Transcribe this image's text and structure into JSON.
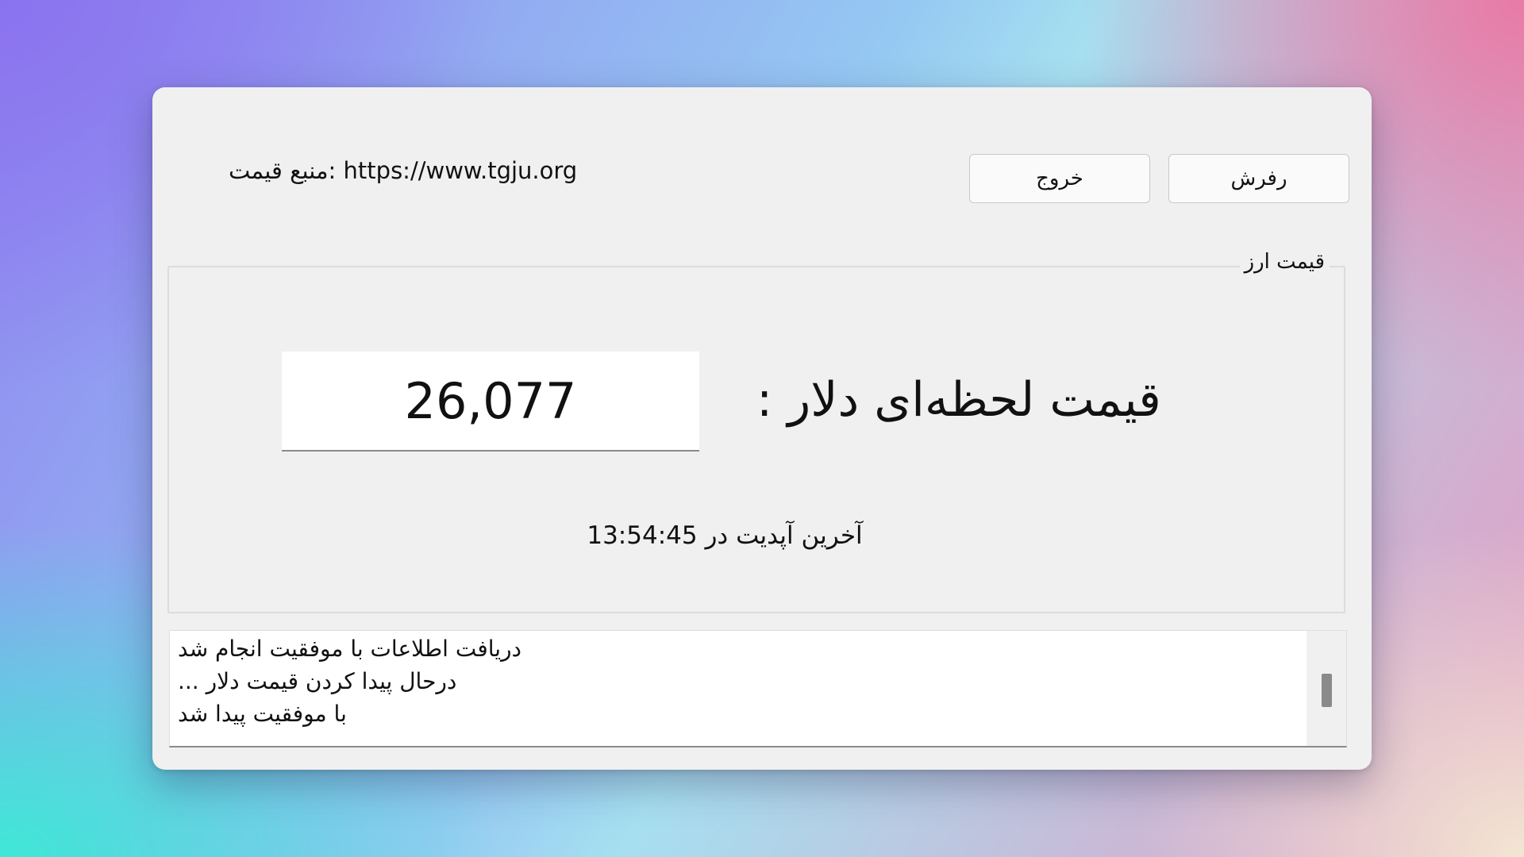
{
  "header": {
    "source_label": "منبع قیمت: https://www.tgju.org"
  },
  "buttons": {
    "exit_label": "خروج",
    "refresh_label": "رفرش"
  },
  "price_group": {
    "title": "قیمت ارز",
    "price_label": "قیمت لحظه‌ای دلار :",
    "price_value": "26,077",
    "last_update": "آخرین آپدیت در 13:54:45"
  },
  "log": {
    "lines": [
      "دریافت اطلاعات با موفقیت انجام شد",
      "درحال پیدا کردن قیمت دلار ...",
      "با موفقیت پیدا شد"
    ]
  }
}
